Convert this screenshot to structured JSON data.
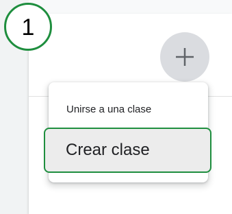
{
  "step": {
    "number": "1"
  },
  "header": {
    "add_button_icon": "plus-icon"
  },
  "menu": {
    "join_label": "Unirse a una clase",
    "create_label": "Crear clase"
  },
  "colors": {
    "highlight": "#1e8e3e",
    "add_button_bg": "#dadce0",
    "selected_item_bg": "#ececec"
  }
}
